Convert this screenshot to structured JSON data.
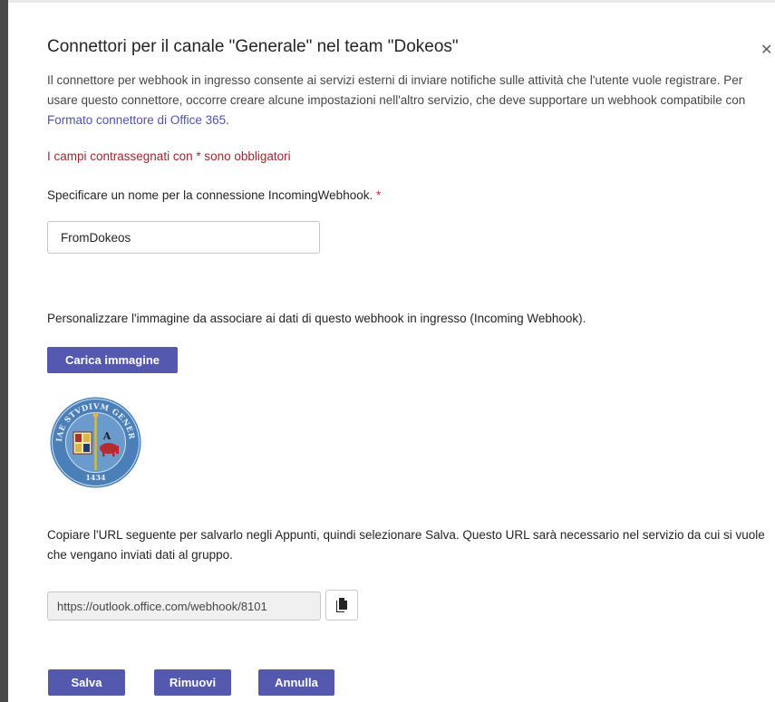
{
  "dialog": {
    "title": "Connettori per il canale \"Generale\" nel team \"Dokeos\"",
    "close_icon": "close-icon",
    "intro_text": "Il connettore per webhook in ingresso consente ai servizi esterni di inviare notifiche sulle attività che l'utente vuole registrare. Per usare questo connettore, occorre creare alcune impostazioni nell'altro servizio, che deve supportare un webhook compatibile con ",
    "intro_link": "Formato connettore di Office 365",
    "intro_end": ".",
    "required_note": "I campi contrassegnati con * sono obbligatori"
  },
  "name_field": {
    "label": "Specificare un nome per la connessione IncomingWebhook.",
    "required_marker": "*",
    "value": "FromDokeos"
  },
  "image_section": {
    "label": "Personalizzare l'immagine da associare ai dati di questo webhook in ingresso (Incoming Webhook).",
    "upload_button": "Carica immagine",
    "seal": {
      "ring_text_top": "SICIAE STVDIVM GENERALE",
      "year": "1434",
      "letter": "A"
    }
  },
  "url_section": {
    "label": "Copiare l'URL seguente per salvarlo negli Appunti, quindi selezionare Salva. Questo URL sarà necessario nel servizio da cui si vuole che vengano inviati dati al gruppo.",
    "url_value": "https://outlook.office.com/webhook/8101",
    "copy_icon": "copy-icon"
  },
  "footer": {
    "save": "Salva",
    "remove": "Rimuovi",
    "cancel": "Annulla"
  },
  "colors": {
    "accent": "#5558af",
    "link": "#4f52b2",
    "error": "#a4262c",
    "seal_blue": "#4a7fb8"
  }
}
